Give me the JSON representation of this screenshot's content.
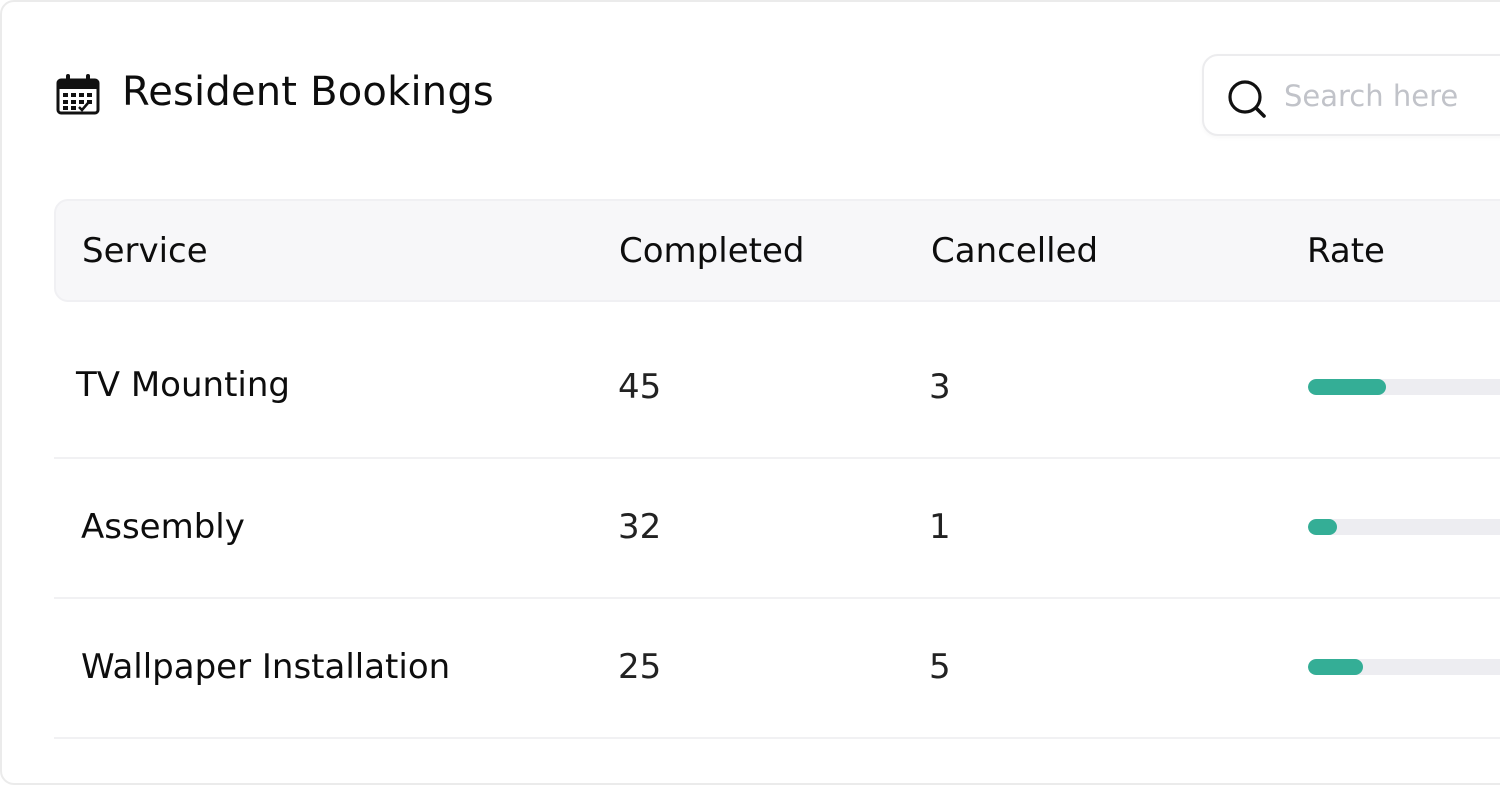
{
  "header": {
    "title": "Resident Bookings",
    "title_icon": "calendar-icon"
  },
  "search": {
    "placeholder": "Search here",
    "value": "",
    "icon": "search-icon"
  },
  "table": {
    "columns": [
      "Service",
      "Completed",
      "Cancelled",
      "Rate"
    ],
    "rows": [
      {
        "service": "TV Mounting",
        "completed": "45",
        "cancelled": "3",
        "rate_fill_fraction": 0.3
      },
      {
        "service": "Assembly",
        "completed": "32",
        "cancelled": "1",
        "rate_fill_fraction": 0.11
      },
      {
        "service": "Wallpaper Installation",
        "completed": "25",
        "cancelled": "5",
        "rate_fill_fraction": 0.21
      }
    ]
  },
  "colors": {
    "accent": "#34ae96",
    "bar_track": "#ededf1",
    "header_bg": "#f7f7f9",
    "placeholder": "#c1c3c9"
  }
}
